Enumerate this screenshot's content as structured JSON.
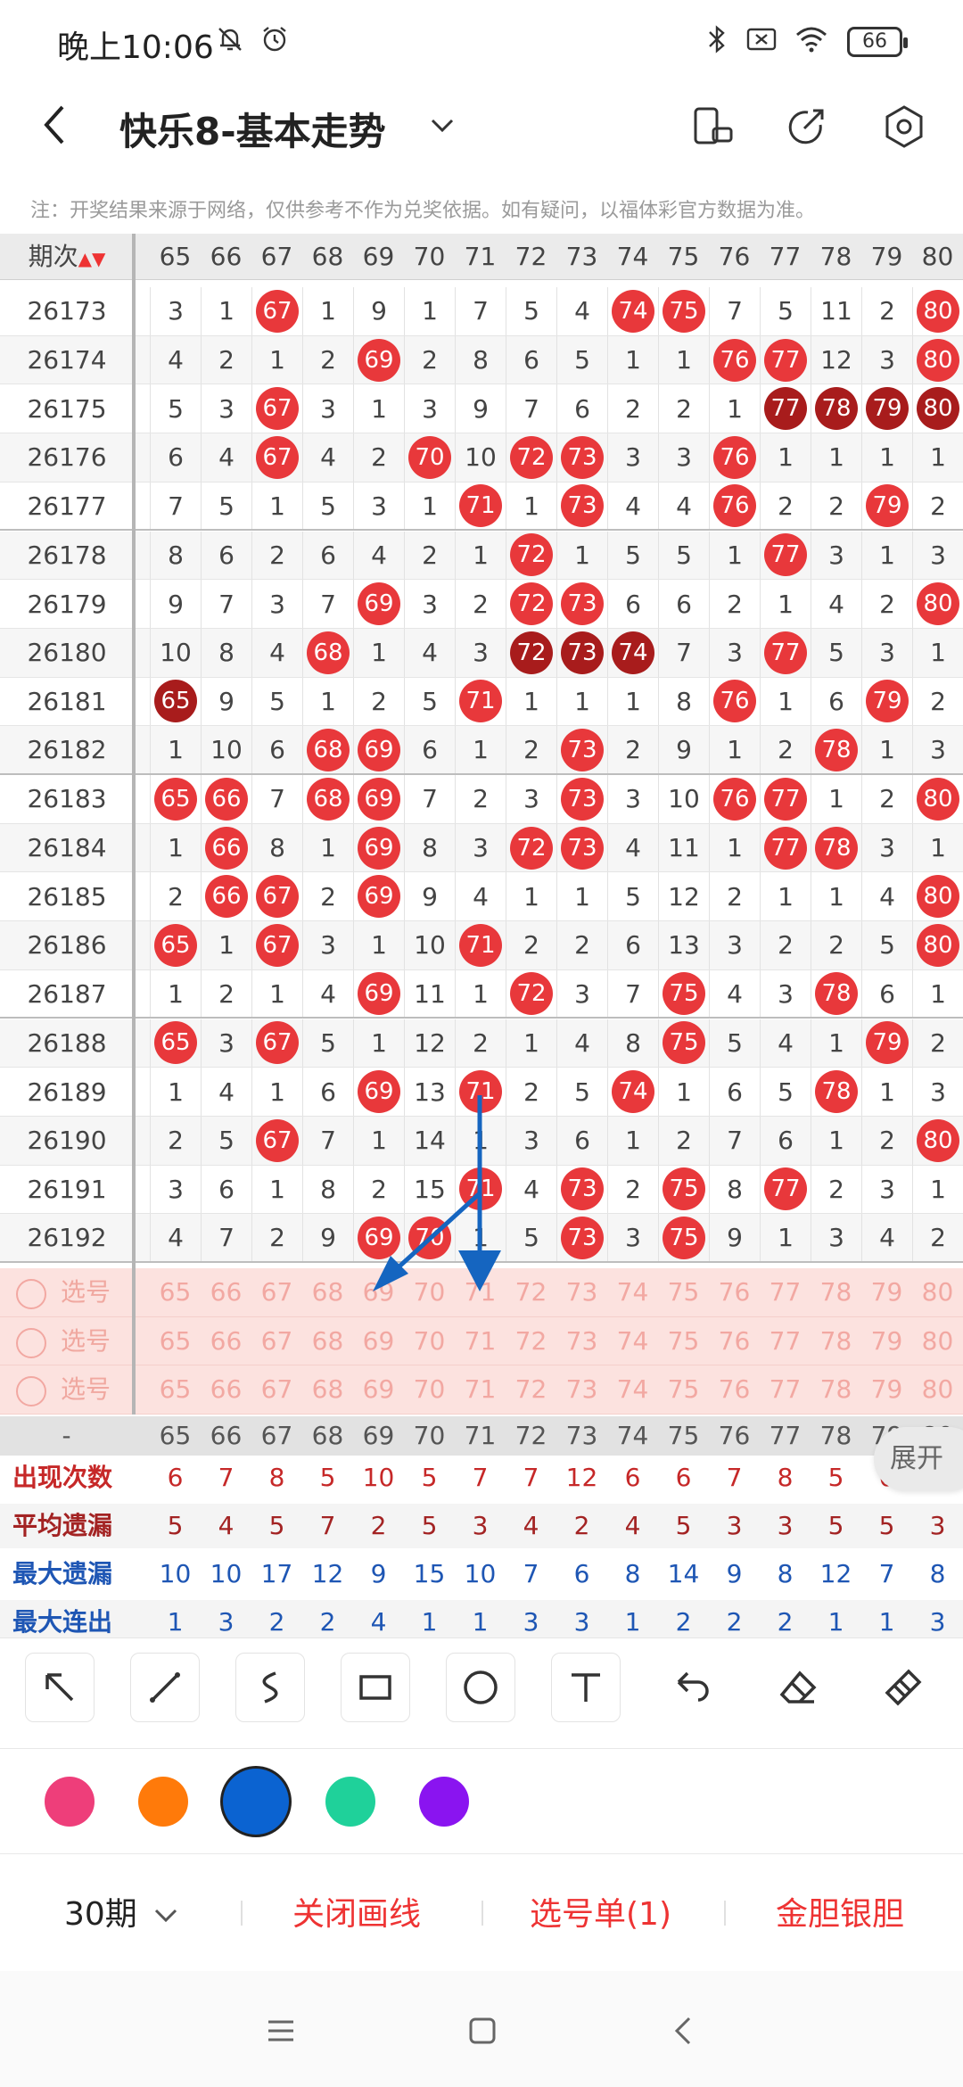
{
  "status_bar": {
    "time": "晚上10:06",
    "battery": "66"
  },
  "app_bar": {
    "title": "快乐8-基本走势"
  },
  "notice": "注：开奖结果来源于网络，仅供参考不作为兑奖依据。如有疑问，以福体彩官方数据为准。",
  "table": {
    "period_header": "期次",
    "columns": [
      "65",
      "66",
      "67",
      "68",
      "69",
      "70",
      "71",
      "72",
      "73",
      "74",
      "75",
      "76",
      "77",
      "78",
      "79",
      "80"
    ],
    "rows": [
      {
        "period": "26173",
        "cells": [
          "3",
          "1",
          "67",
          "1",
          "9",
          "1",
          "7",
          "5",
          "4",
          "74",
          "75",
          "7",
          "5",
          "11",
          "2",
          "80"
        ]
      },
      {
        "period": "26174",
        "cells": [
          "4",
          "2",
          "1",
          "2",
          "69",
          "2",
          "8",
          "6",
          "5",
          "1",
          "1",
          "76",
          "77",
          "12",
          "3",
          "80"
        ]
      },
      {
        "period": "26175",
        "cells": [
          "5",
          "3",
          "67",
          "3",
          "1",
          "3",
          "9",
          "7",
          "6",
          "2",
          "2",
          "1",
          "77",
          "78",
          "79",
          "80"
        ]
      },
      {
        "period": "26176",
        "cells": [
          "6",
          "4",
          "67",
          "4",
          "2",
          "70",
          "10",
          "72",
          "73",
          "3",
          "3",
          "76",
          "1",
          "1",
          "1",
          "1"
        ]
      },
      {
        "period": "26177",
        "cells": [
          "7",
          "5",
          "1",
          "5",
          "3",
          "1",
          "71",
          "1",
          "73",
          "4",
          "4",
          "76",
          "2",
          "2",
          "79",
          "2"
        ]
      },
      {
        "period": "26178",
        "cells": [
          "8",
          "6",
          "2",
          "6",
          "4",
          "2",
          "1",
          "72",
          "1",
          "5",
          "5",
          "1",
          "77",
          "3",
          "1",
          "3"
        ]
      },
      {
        "period": "26179",
        "cells": [
          "9",
          "7",
          "3",
          "7",
          "69",
          "3",
          "2",
          "72",
          "73",
          "6",
          "6",
          "2",
          "1",
          "4",
          "2",
          "80"
        ]
      },
      {
        "period": "26180",
        "cells": [
          "10",
          "8",
          "4",
          "68",
          "1",
          "4",
          "3",
          "72",
          "73",
          "74",
          "7",
          "3",
          "77",
          "5",
          "3",
          "1"
        ]
      },
      {
        "period": "26181",
        "cells": [
          "65",
          "9",
          "5",
          "1",
          "2",
          "5",
          "71",
          "1",
          "1",
          "1",
          "8",
          "76",
          "1",
          "6",
          "79",
          "2"
        ]
      },
      {
        "period": "26182",
        "cells": [
          "1",
          "10",
          "6",
          "68",
          "69",
          "6",
          "1",
          "2",
          "73",
          "2",
          "9",
          "1",
          "2",
          "78",
          "1",
          "3"
        ]
      },
      {
        "period": "26183",
        "cells": [
          "65",
          "66",
          "7",
          "68",
          "69",
          "7",
          "2",
          "3",
          "73",
          "3",
          "10",
          "76",
          "77",
          "1",
          "2",
          "80"
        ]
      },
      {
        "period": "26184",
        "cells": [
          "1",
          "66",
          "8",
          "1",
          "69",
          "8",
          "3",
          "72",
          "73",
          "4",
          "11",
          "1",
          "77",
          "78",
          "3",
          "1"
        ]
      },
      {
        "period": "26185",
        "cells": [
          "2",
          "66",
          "67",
          "2",
          "69",
          "9",
          "4",
          "1",
          "1",
          "5",
          "12",
          "2",
          "1",
          "1",
          "4",
          "80"
        ]
      },
      {
        "period": "26186",
        "cells": [
          "65",
          "1",
          "67",
          "3",
          "1",
          "10",
          "71",
          "2",
          "2",
          "6",
          "13",
          "3",
          "2",
          "2",
          "5",
          "80"
        ]
      },
      {
        "period": "26187",
        "cells": [
          "1",
          "2",
          "1",
          "4",
          "69",
          "11",
          "1",
          "72",
          "3",
          "7",
          "75",
          "4",
          "3",
          "78",
          "6",
          "1"
        ]
      },
      {
        "period": "26188",
        "cells": [
          "65",
          "3",
          "67",
          "5",
          "1",
          "12",
          "2",
          "1",
          "4",
          "8",
          "75",
          "5",
          "4",
          "1",
          "79",
          "2"
        ]
      },
      {
        "period": "26189",
        "cells": [
          "1",
          "4",
          "1",
          "6",
          "69",
          "13",
          "71",
          "2",
          "5",
          "74",
          "1",
          "6",
          "5",
          "78",
          "1",
          "3"
        ]
      },
      {
        "period": "26190",
        "cells": [
          "2",
          "5",
          "67",
          "7",
          "1",
          "14",
          "1",
          "3",
          "6",
          "1",
          "2",
          "7",
          "6",
          "1",
          "2",
          "80"
        ]
      },
      {
        "period": "26191",
        "cells": [
          "3",
          "6",
          "1",
          "8",
          "2",
          "15",
          "71",
          "4",
          "73",
          "2",
          "75",
          "8",
          "77",
          "2",
          "3",
          "1"
        ]
      },
      {
        "period": "26192",
        "cells": [
          "4",
          "7",
          "2",
          "9",
          "69",
          "70",
          "1",
          "5",
          "73",
          "3",
          "75",
          "9",
          "1",
          "3",
          "4",
          "2"
        ]
      }
    ]
  },
  "pick_rows": [
    {
      "label": "选号"
    },
    {
      "label": "选号"
    },
    {
      "label": "选号"
    }
  ],
  "stats": {
    "header_dash": "-",
    "expand_label": "展开",
    "rows": [
      {
        "label": "出现次数",
        "color": "#c62828",
        "values": [
          "6",
          "7",
          "8",
          "5",
          "10",
          "5",
          "7",
          "7",
          "12",
          "6",
          "6",
          "7",
          "8",
          "5",
          "6",
          "7"
        ]
      },
      {
        "label": "平均遗漏",
        "color": "#a32323",
        "values": [
          "5",
          "4",
          "5",
          "7",
          "2",
          "5",
          "3",
          "4",
          "2",
          "4",
          "5",
          "3",
          "3",
          "5",
          "5",
          "3"
        ]
      },
      {
        "label": "最大遗漏",
        "color": "#1e56b4",
        "values": [
          "10",
          "10",
          "17",
          "12",
          "9",
          "15",
          "10",
          "7",
          "6",
          "8",
          "14",
          "9",
          "8",
          "12",
          "7",
          "8"
        ]
      },
      {
        "label": "最大连出",
        "color": "#1e56b4",
        "values": [
          "1",
          "3",
          "2",
          "2",
          "4",
          "1",
          "1",
          "3",
          "3",
          "1",
          "2",
          "2",
          "2",
          "1",
          "1",
          "3"
        ]
      }
    ]
  },
  "tools": [
    "arrow-tool",
    "line-tool",
    "curve-tool",
    "rectangle-tool",
    "circle-tool",
    "text-tool",
    "undo-tool",
    "eraser-tool",
    "clear-tool"
  ],
  "colors": [
    "#ee3e7a",
    "#ff7a0a",
    "#0b63d1",
    "#1fd19a",
    "#8a14f0"
  ],
  "bottom_bar": {
    "periods": "30期",
    "close_drawing": "关闭画线",
    "pick_list": "选号单(1)",
    "gold_silver": "金胆银胆"
  }
}
